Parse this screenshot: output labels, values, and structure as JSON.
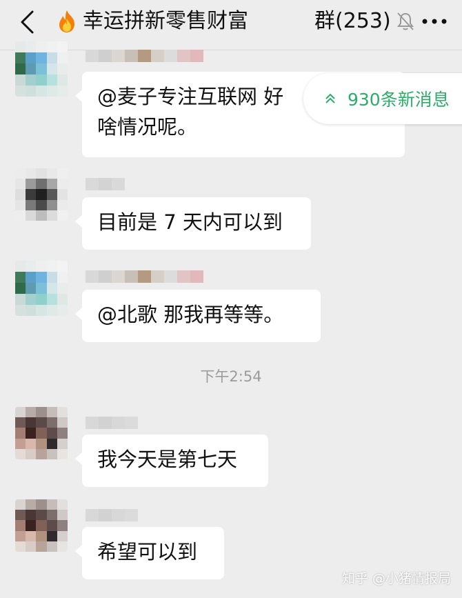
{
  "header": {
    "title": "幸运拼新零售财富",
    "group_label": "群(253)"
  },
  "new_messages": {
    "label": "930条新消息"
  },
  "messages": [
    {
      "lines": [
        "@麦子专注互联网  好",
        "啥情况呢。"
      ]
    },
    {
      "lines": [
        "目前是 7 天内可以到"
      ]
    },
    {
      "lines": [
        "@北歌   那我再等等。"
      ]
    },
    {
      "lines": [
        "我今天是第七天"
      ]
    },
    {
      "lines": [
        "希望可以到"
      ]
    }
  ],
  "timestamp": "下午2:54",
  "watermark": "知乎 @小猪情报局",
  "colors": {
    "background": "#ededed",
    "bubble": "#ffffff",
    "accent_green": "#2aae67",
    "timestamp": "#9b9b9b"
  },
  "icons": [
    "back-chevron-icon",
    "fire-emoji-icon",
    "mute-bell-icon",
    "more-dots-icon",
    "double-chevron-up-icon"
  ]
}
